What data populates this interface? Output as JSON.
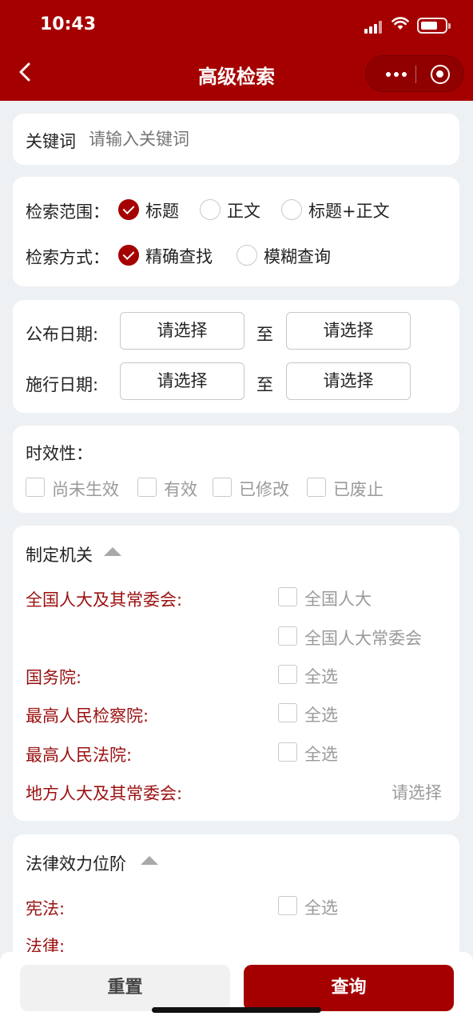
{
  "status_bar": {
    "time": "10:43"
  },
  "nav": {
    "title": "高级检索"
  },
  "keyword": {
    "label": "关键词",
    "placeholder": "请输入关键词"
  },
  "search_scope": {
    "label": "检索范围：",
    "options": [
      {
        "label": "标题",
        "selected": true
      },
      {
        "label": "正文",
        "selected": false
      },
      {
        "label": "标题+正文",
        "selected": false
      }
    ]
  },
  "search_mode": {
    "label": "检索方式：",
    "options": [
      {
        "label": "精确查找",
        "selected": true
      },
      {
        "label": "模糊查询",
        "selected": false
      }
    ]
  },
  "dates": {
    "publish": {
      "label": "公布日期:",
      "from": "请选择",
      "to": "请选择"
    },
    "effective": {
      "label": "施行日期:",
      "from": "请选择",
      "to": "请选择"
    },
    "separator": "至"
  },
  "validity": {
    "label": "时效性：",
    "options": [
      "尚未生效",
      "有效",
      "已修改",
      "已废止"
    ]
  },
  "authority": {
    "title": "制定机关",
    "groups": [
      {
        "name": "全国人大及其常委会:",
        "options": [
          "全国人大",
          "全国人大常委会"
        ]
      },
      {
        "name": "国务院:",
        "options": [
          "全选"
        ]
      },
      {
        "name": "最高人民检察院:",
        "options": [
          "全选"
        ]
      },
      {
        "name": "最高人民法院:",
        "options": [
          "全选"
        ]
      },
      {
        "name": "地方人大及其常委会:",
        "select_label": "请选择"
      }
    ]
  },
  "legal_level": {
    "title": "法律效力位阶",
    "groups": [
      {
        "name": "宪法:",
        "options": [
          "全选"
        ]
      },
      {
        "name": "法律:"
      }
    ]
  },
  "footer": {
    "reset": "重置",
    "query": "查询"
  },
  "colors": {
    "brand": "#a50000",
    "category_text": "#9b1111",
    "page_bg": "#eef1f4"
  }
}
